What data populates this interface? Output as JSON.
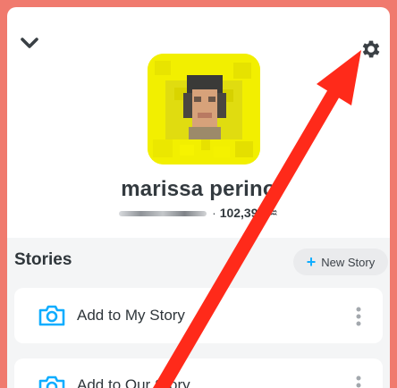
{
  "header": {
    "collapse_icon": "chevron-down-icon",
    "settings_icon": "gear-icon"
  },
  "profile": {
    "name": "marissa perino",
    "separator": "·",
    "score": "102,390",
    "zodiac": "♒",
    "avatar_color": "#f2f000"
  },
  "stories": {
    "title": "Stories",
    "new_story_label": "New Story",
    "items": [
      {
        "label": "Add to My Story",
        "icon": "camera-icon"
      },
      {
        "label": "Add to Our Story",
        "icon": "camera-icon"
      }
    ]
  },
  "annotation": {
    "color": "#ff2a1a",
    "description": "red arrow pointing to settings gear"
  },
  "colors": {
    "accent": "#0fadff",
    "frame": "#f07a6e"
  }
}
